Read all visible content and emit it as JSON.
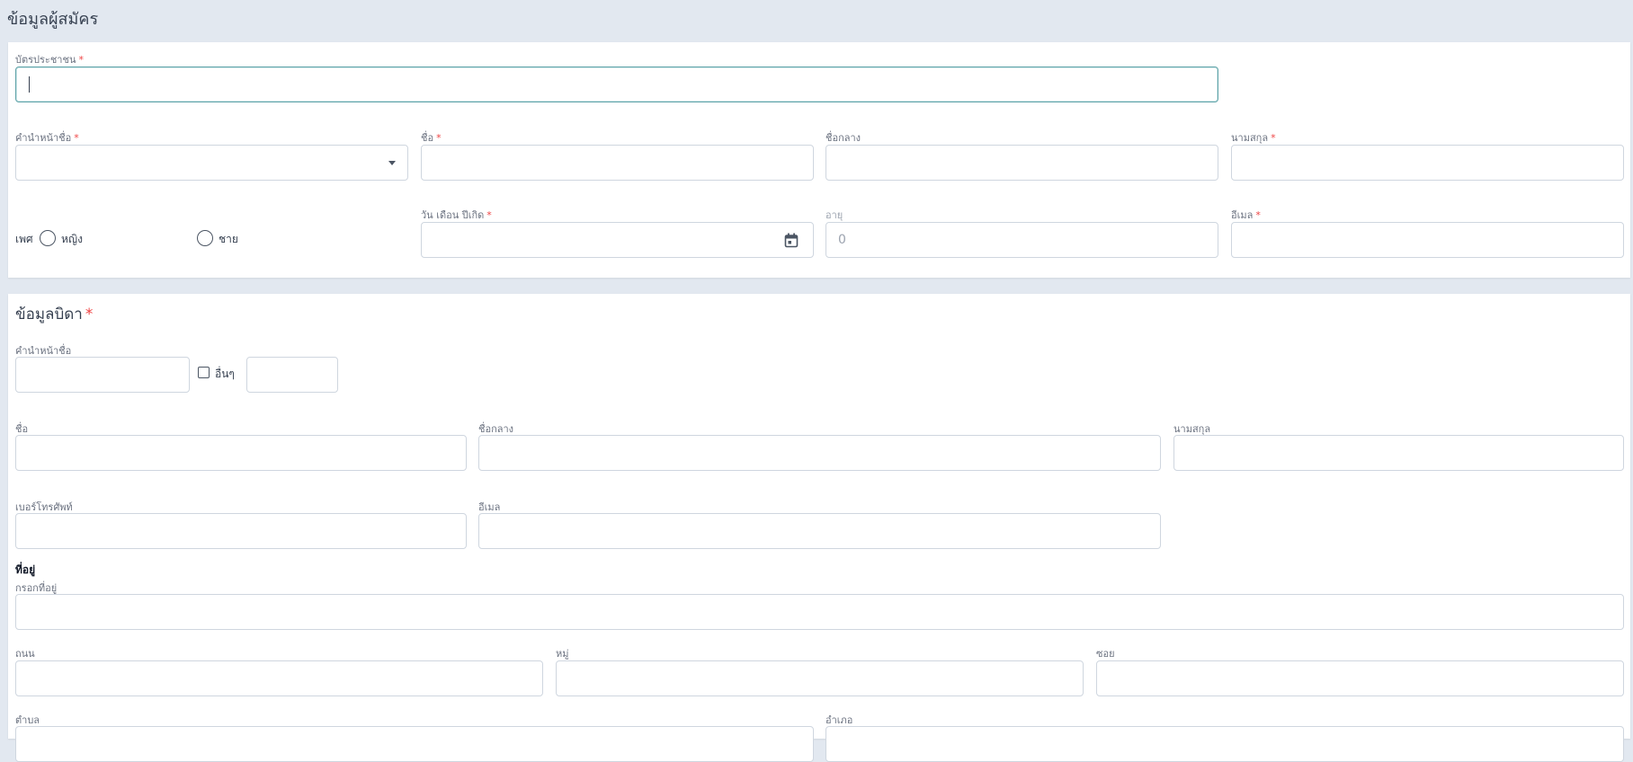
{
  "applicant": {
    "title": "ข้อมูลผู้สมัคร",
    "id_card": {
      "label": "บัตรประชาชน",
      "value": ""
    },
    "prefix": {
      "label": "คำนำหน้าชื่อ",
      "value": ""
    },
    "first_name": {
      "label": "ชื่อ",
      "value": ""
    },
    "middle_name": {
      "label": "ชื่อกลาง",
      "value": ""
    },
    "last_name": {
      "label": "นามสกุล",
      "value": ""
    },
    "gender": {
      "label": "เพศ",
      "options": [
        "หญิง",
        "ชาย"
      ]
    },
    "birth_date": {
      "label": "วัน เดือน ปีเกิด",
      "value": ""
    },
    "age": {
      "label": "อายุ",
      "value": "0"
    },
    "email": {
      "label": "อีเมล",
      "value": ""
    }
  },
  "father": {
    "title": "ข้อมูลบิดา",
    "prefix": {
      "label": "คำนำหน้าชื่อ",
      "value": ""
    },
    "other": {
      "label": "อื่นๆ",
      "checked": false
    },
    "first_name": {
      "label": "ชื่อ"
    },
    "middle_name": {
      "label": "ชื่อกลาง"
    },
    "last_name": {
      "label": "นามสกุล"
    },
    "phone": {
      "label": "เบอร์โทรศัพท์"
    },
    "email": {
      "label": "อีเมล"
    },
    "address": {
      "heading": "ที่อยู่",
      "fill_label": "กรอกที่อยู่",
      "road_label": "ถนน",
      "moo_label": "หมู่",
      "soi_label": "ซอย",
      "subdistrict_label": "ตำบล",
      "district_label": "อำเภอ"
    }
  },
  "required_marker": "*",
  "colors": {
    "background": "#e2e8f0",
    "required": "#ef4444",
    "focus_border": "#5fa3a8"
  }
}
